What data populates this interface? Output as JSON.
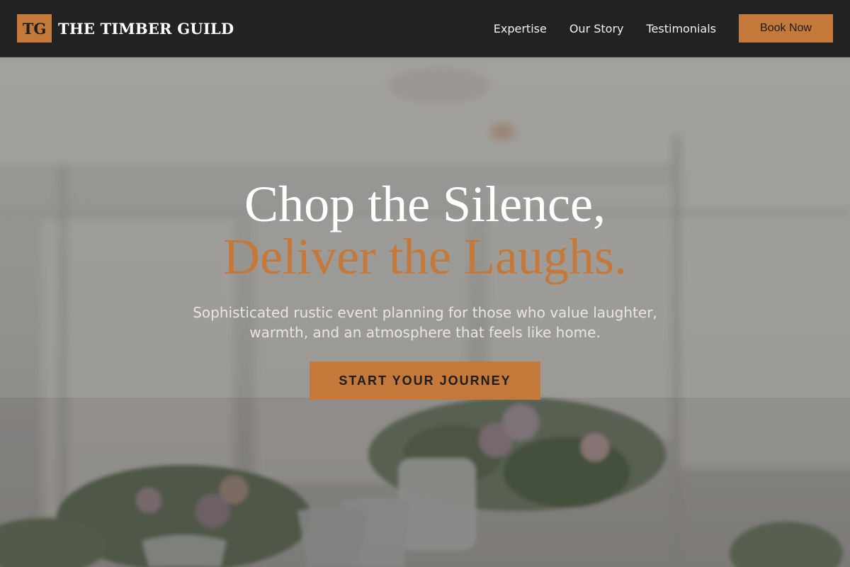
{
  "brand": {
    "logo_initials": "TG",
    "name": "THE TIMBER GUILD"
  },
  "nav": {
    "links": [
      "Expertise",
      "Our Story",
      "Testimonials"
    ],
    "book_label": "Book Now"
  },
  "hero": {
    "headline_line1": "Chop the Silence,",
    "headline_line2": "Deliver the Laughs.",
    "subtitle": "Sophisticated rustic event planning for those who value laughter, warmth, and an atmosphere that feels like home.",
    "cta_label": "START YOUR JOURNEY"
  },
  "colors": {
    "accent": "#c4783a",
    "nav_background": "#222222",
    "text_light": "#ffffff",
    "text_dark": "#1d1d1d"
  }
}
